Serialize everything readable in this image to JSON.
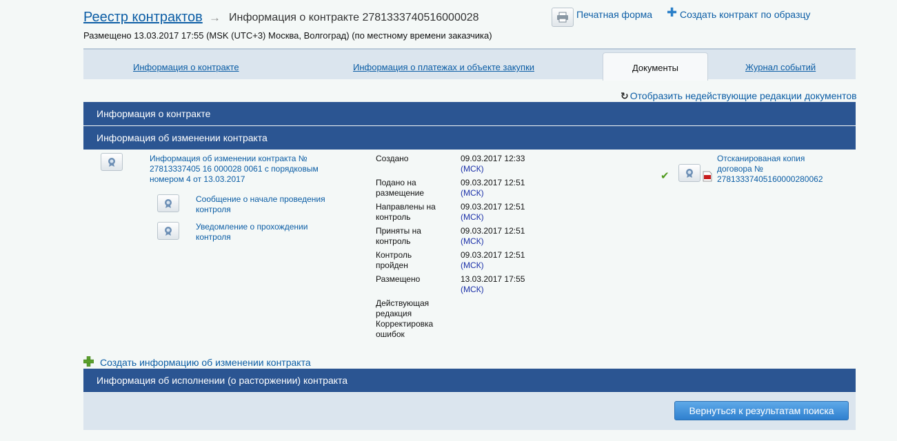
{
  "header": {
    "root_link": "Реестр контрактов",
    "arrow": "→",
    "current_title": "Информация о контракте 2781333740516000028",
    "posted": "Размещено 13.03.2017 17:55 (MSK (UTC+3) Москва, Волгоград) (по местному времени заказчика)",
    "print_label": "Печатная форма",
    "create_by_sample_label": "Создать контракт по образцу"
  },
  "tabs": [
    {
      "label": "Информация о контракте"
    },
    {
      "label": "Информация о платежах и объекте закупки"
    },
    {
      "label": "Документы",
      "active": true
    },
    {
      "label": "Журнал событий"
    }
  ],
  "show_inactive_label": "Отобразить недействующие редакции документов",
  "sections": {
    "contract_info": "Информация о контракте",
    "change_info": "Информация об изменении контракта",
    "execution_info": "Информация об исполнении (о расторжении) контракта"
  },
  "change_document": {
    "main_link": "Информация об изменении контракта № 27813337405 16 000028 0061 с порядковым номером 4 от 13.03.2017",
    "sub_links": [
      "Сообщение о начале проведения контроля",
      "Уведомление о прохождении контроля"
    ],
    "status_rows": [
      {
        "label": "Создано",
        "date": "09.03.2017 12:33",
        "tz": "(МСК)"
      },
      {
        "label": "Подано на размещение",
        "date": "09.03.2017 12:51",
        "tz": "(МСК)"
      },
      {
        "label": "Направлены на контроль",
        "date": "09.03.2017 12:51",
        "tz": "(МСК)"
      },
      {
        "label": "Приняты на контроль",
        "date": "09.03.2017 12:51",
        "tz": "(МСК)"
      },
      {
        "label": "Контроль пройден",
        "date": "09.03.2017 12:51",
        "tz": "(МСК)"
      },
      {
        "label": "Размещено",
        "date": "13.03.2017 17:55",
        "tz": "(МСК)"
      }
    ],
    "edition_note": "Действующая редакция Корректировка ошибок",
    "scan_link": "Отсканированая копия договора № 27813337405160000280062"
  },
  "create_change_label": "Создать информацию об изменении контракта",
  "back_button_label": "Вернуться к результатам поиска",
  "colors": {
    "section_bar": "#2b5592",
    "link": "#0b5da5",
    "tab_bar": "#dbe5ee"
  },
  "icons": [
    "print-icon",
    "plus-icon",
    "refresh-icon",
    "certificate-icon",
    "check-icon",
    "pdf-icon",
    "plus-green-icon"
  ]
}
